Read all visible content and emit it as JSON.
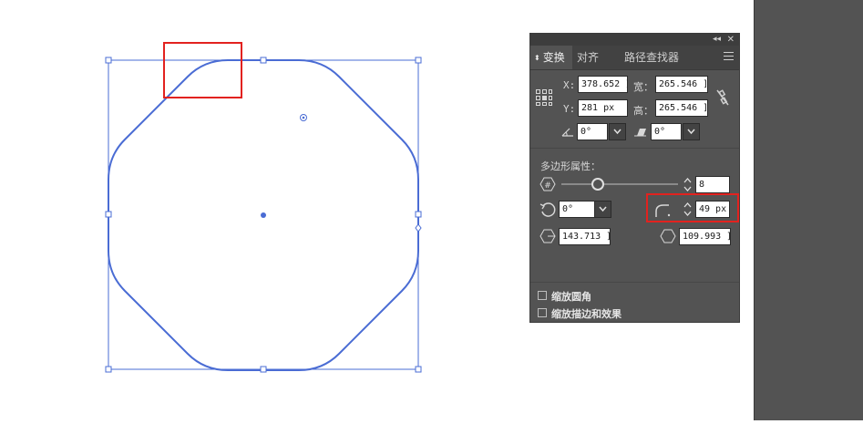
{
  "panel": {
    "tabs": [
      {
        "label": "变换",
        "active": true
      },
      {
        "label": "对齐",
        "active": false
      },
      {
        "label": "路径查找器",
        "active": false
      }
    ],
    "x_label": "X:",
    "x_value": "378.652 ]",
    "y_label": "Y:",
    "y_value": "281 px",
    "width_label": "宽：",
    "width_value": "265.546 ]",
    "height_label": "高：",
    "height_value": "265.546 ]",
    "rotate_value": "0°",
    "shear_value": "0°",
    "polygon_section_title": "多边形属性：",
    "side_count": "8",
    "polygon_rotation": "0°",
    "corner_radius": "49 px",
    "side_length": "143.713 ]",
    "radius_value": "109.993 ]",
    "scale_corners_label": "缩放圆角",
    "scale_strokes_label": "缩放描边和效果"
  },
  "colors": {
    "panel_bg": "#535353",
    "selection": "#4a6cd4",
    "highlight": "#e2221f"
  },
  "icons": [
    "collapse-icon",
    "close-icon",
    "panel-menu-icon",
    "reference-point-icon",
    "link-proportions-icon",
    "rotate-icon",
    "shear-icon",
    "polygon-sides-icon",
    "polygon-rotate-icon",
    "corner-radius-icon",
    "side-length-icon",
    "polygon-radius-icon"
  ]
}
